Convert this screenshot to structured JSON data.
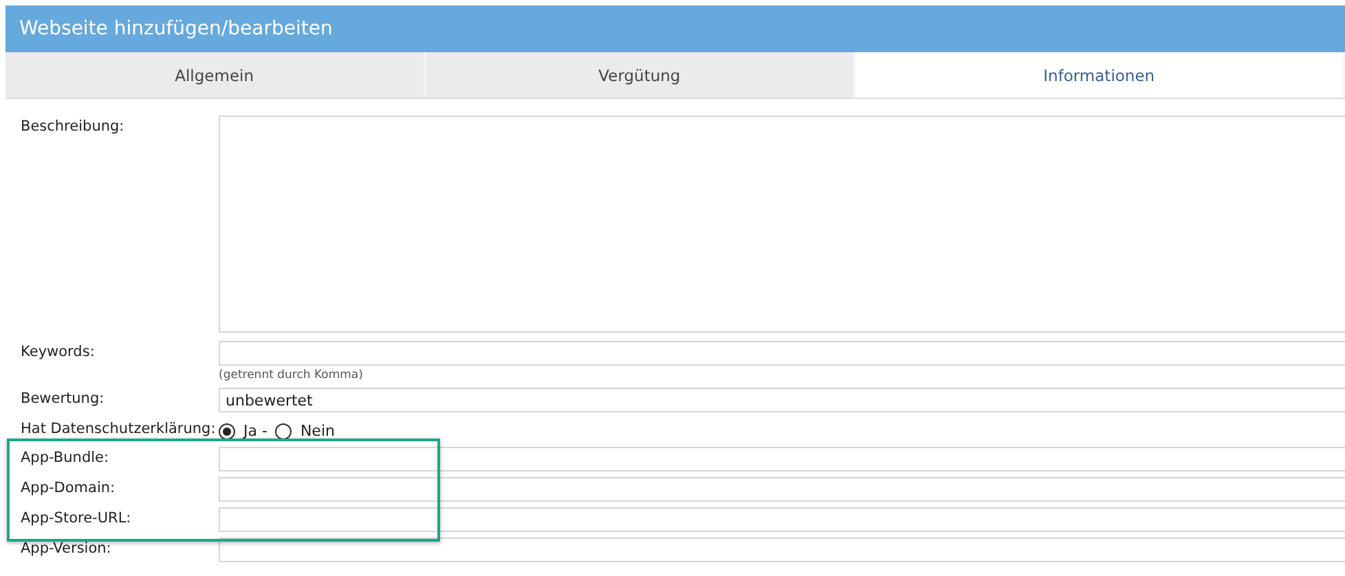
{
  "window": {
    "title": "Webseite hinzufügen/bearbeiten"
  },
  "tabs": [
    {
      "label": "Allgemein",
      "selected": false
    },
    {
      "label": "Vergütung",
      "selected": false
    },
    {
      "label": "Informationen",
      "selected": true
    }
  ],
  "fields": [
    {
      "kind": "textarea",
      "label": "Beschreibung:",
      "highlighted": false
    },
    {
      "kind": "text",
      "label": "Keywords:",
      "hint": "(getrennt durch Komma)",
      "highlighted": false
    },
    {
      "kind": "text",
      "label": "Bewertung:",
      "value": "unbewertet",
      "highlighted": false
    },
    {
      "kind": "radio",
      "label": "Hat Datenschutzerklärung:",
      "options": [
        {
          "label": "Ja -",
          "selected": true
        },
        {
          "label": "Nein",
          "selected": false
        }
      ],
      "highlighted": false
    },
    {
      "kind": "text",
      "label": "App-Bundle:",
      "highlighted": true
    },
    {
      "kind": "text",
      "label": "App-Domain:",
      "highlighted": true
    },
    {
      "kind": "text",
      "label": "App-Store-URL:",
      "highlighted": true
    },
    {
      "kind": "text",
      "label": "App-Version:",
      "highlighted": false
    }
  ]
}
